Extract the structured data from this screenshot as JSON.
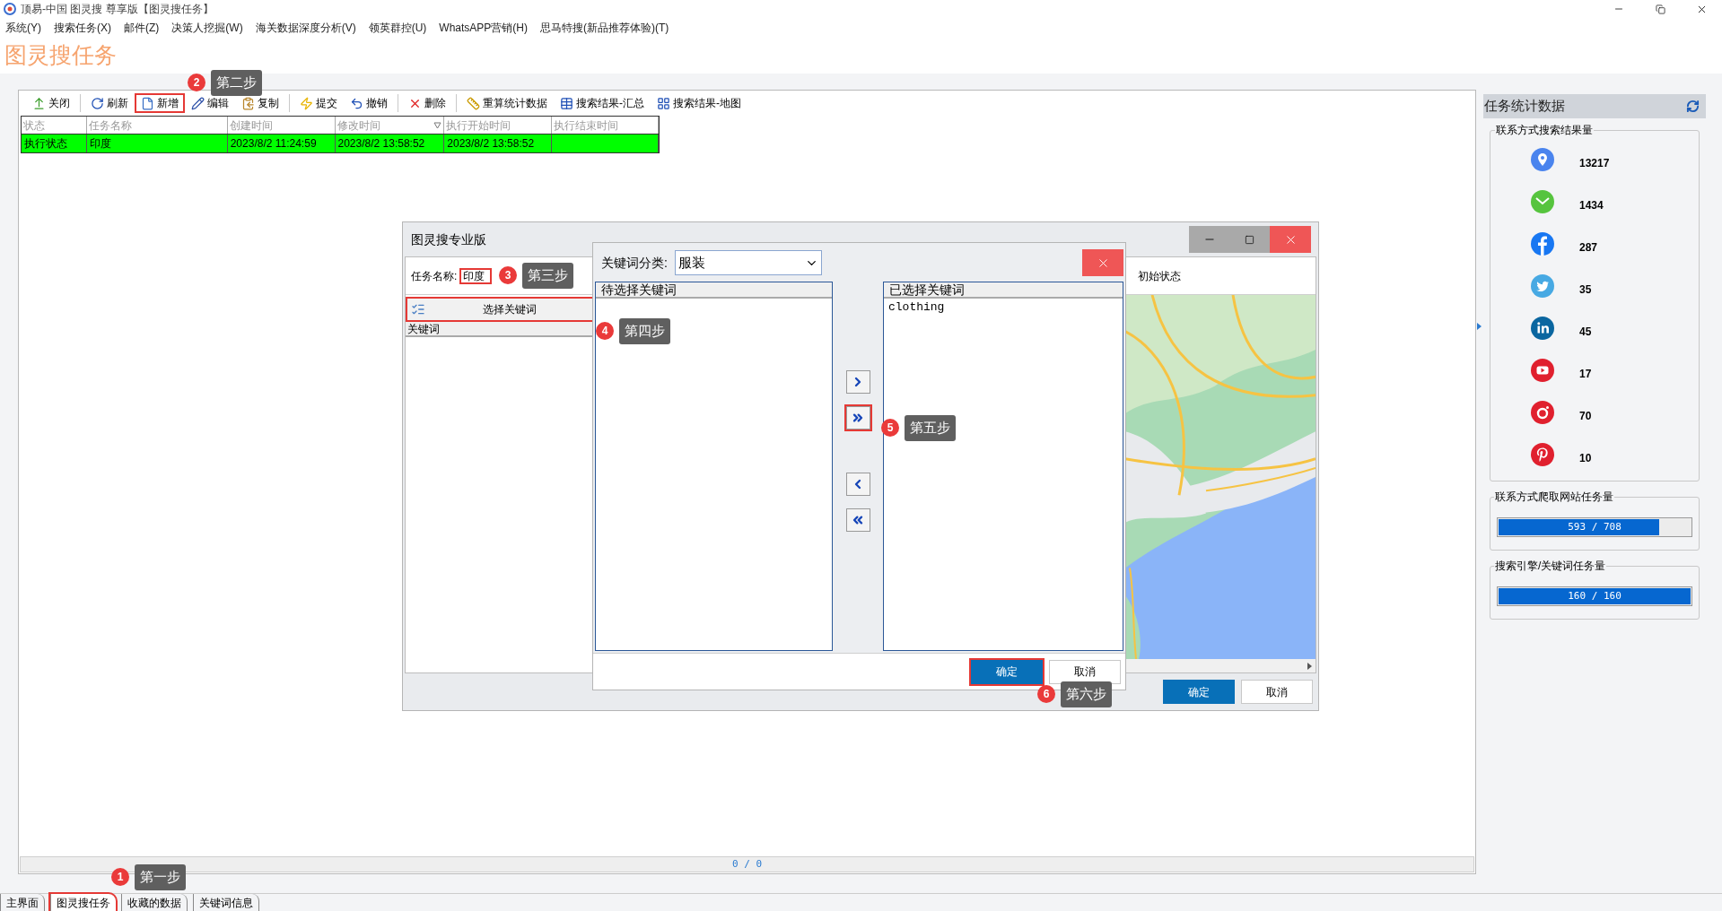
{
  "window": {
    "title": "顶易-中国 图灵搜 尊享版【图灵搜任务】"
  },
  "menu": [
    "系统(Y)",
    "搜索任务(X)",
    "邮件(Z)",
    "决策人挖掘(W)",
    "海关数据深度分析(V)",
    "领英群控(U)",
    "WhatsAPP营销(H)",
    "思马特搜(新品推荐体验)(T)"
  ],
  "page_title": "图灵搜任务",
  "toolbar": [
    [
      {
        "kind": "close",
        "label": "关闭",
        "highlighted": false
      }
    ],
    [
      {
        "kind": "refresh",
        "label": "刷新",
        "highlighted": false
      },
      {
        "kind": "new",
        "label": "新增",
        "highlighted": true
      },
      {
        "kind": "edit",
        "label": "编辑",
        "highlighted": false
      },
      {
        "kind": "copy",
        "label": "复制",
        "highlighted": false
      }
    ],
    [
      {
        "kind": "submit",
        "label": "提交",
        "highlighted": false
      },
      {
        "kind": "undo",
        "label": "撤销",
        "highlighted": false
      }
    ],
    [
      {
        "kind": "delete",
        "label": "删除",
        "highlighted": false
      }
    ],
    [
      {
        "kind": "recalc",
        "label": "重算统计数据",
        "highlighted": false
      },
      {
        "kind": "summary",
        "label": "搜索结果-汇总",
        "highlighted": false
      },
      {
        "kind": "map",
        "label": "搜索结果-地图",
        "highlighted": false
      }
    ]
  ],
  "table": {
    "columns": [
      {
        "label": "状态",
        "sorted": false
      },
      {
        "label": "任务名称",
        "sorted": false
      },
      {
        "label": "创建时间",
        "sorted": false
      },
      {
        "label": "修改时间",
        "sorted": true
      },
      {
        "label": "执行开始时间",
        "sorted": false
      },
      {
        "label": "执行结束时间",
        "sorted": false
      }
    ],
    "rows": [
      {
        "color": "#00ff00",
        "cells": [
          "执行状态",
          "印度",
          "2023/8/2 11:24:59",
          "2023/8/2 13:58:52",
          "2023/8/2 13:58:52",
          ""
        ]
      }
    ]
  },
  "status_bar": "0 / 0",
  "tabs": [
    {
      "label": "主界面",
      "selected": false,
      "highlighted": false
    },
    {
      "label": "图灵搜任务",
      "selected": true,
      "highlighted": true
    },
    {
      "label": "收藏的数据",
      "selected": false,
      "highlighted": false
    },
    {
      "label": "关键词信息",
      "selected": false,
      "highlighted": false
    }
  ],
  "stats_panel": {
    "title": "任务统计数据",
    "results_group": {
      "title": "联系方式搜索结果量",
      "items": [
        {
          "kind": "location",
          "value": "13217"
        },
        {
          "kind": "email",
          "value": "1434"
        },
        {
          "kind": "facebook",
          "value": "287"
        },
        {
          "kind": "twitter",
          "value": "35"
        },
        {
          "kind": "linkedin",
          "value": "45"
        },
        {
          "kind": "youtube",
          "value": "17"
        },
        {
          "kind": "instagram",
          "value": "70"
        },
        {
          "kind": "pinterest",
          "value": "10"
        }
      ]
    },
    "progress_groups": [
      {
        "title": "联系方式爬取网站任务量",
        "level": 0.8376,
        "reading": "593 / 708"
      },
      {
        "title": "搜索引擎/关键词任务量",
        "level": 1,
        "reading": "160 / 160"
      }
    ]
  },
  "dialog": {
    "title": "图灵搜专业版",
    "task_name_label": "任务名称:",
    "task_name": {
      "value": "印度",
      "highlighted": true
    },
    "status": "初始状态",
    "select_button": {
      "label": "选择关键词",
      "highlighted": true
    },
    "list_header": "关键词",
    "buttons": [
      {
        "label": "确定",
        "primary": true
      },
      {
        "label": "取消",
        "primary": false
      }
    ]
  },
  "keyword_dialog": {
    "category_label": "关键词分类:",
    "category_value": "服装",
    "available_header": "待选择关键词",
    "selected_header": "已选择关键词",
    "selected_keywords": [
      "clothing"
    ],
    "move_buttons": [
      {
        "kind": "add",
        "highlighted": false
      },
      {
        "kind": "add_all",
        "highlighted": true
      },
      {
        "kind": "remove",
        "highlighted": false
      },
      {
        "kind": "remove_all",
        "highlighted": false
      }
    ],
    "buttons": [
      {
        "label": "确定",
        "primary": true,
        "highlighted": true
      },
      {
        "label": "取消",
        "primary": false,
        "highlighted": false
      }
    ]
  },
  "annotations": [
    {
      "number": "1",
      "label": "第一步"
    },
    {
      "number": "2",
      "label": "第二步"
    },
    {
      "number": "3",
      "label": "第三步"
    },
    {
      "number": "4",
      "label": "第四步"
    },
    {
      "number": "5",
      "label": "第五步"
    },
    {
      "number": "6",
      "label": "第六步"
    }
  ]
}
